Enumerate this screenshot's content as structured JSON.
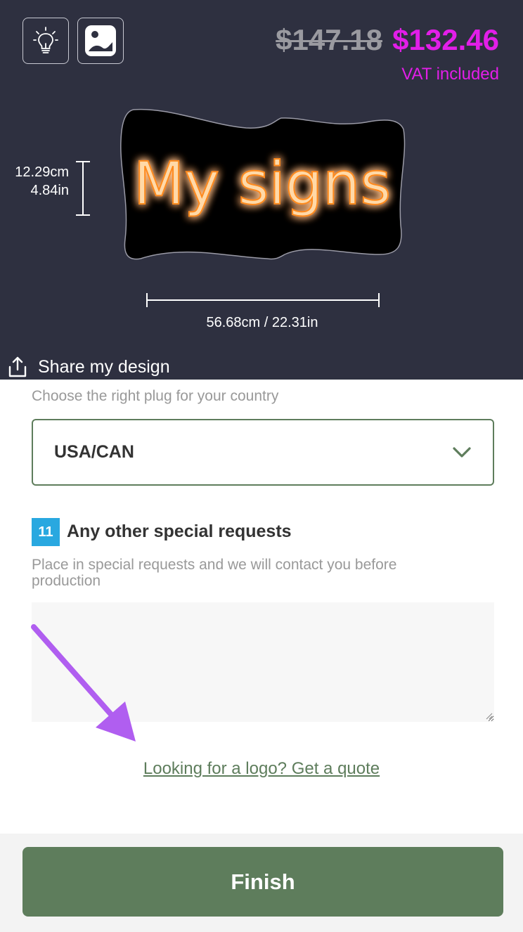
{
  "colors": {
    "accent": "#e21ee8",
    "primary_green": "#5e7d5c",
    "step_blue": "#29a8e0",
    "preview_bg": "#2e3040",
    "neon_orange": "#ff8a1c"
  },
  "toolbar": {
    "icons": [
      "lightbulb-icon",
      "image-icon"
    ]
  },
  "price": {
    "original": "$147.18",
    "current": "$132.46",
    "vat_note": "VAT included"
  },
  "sign": {
    "text": "My signs",
    "height_cm": "12.29cm",
    "height_in": "4.84in",
    "width_label": "56.68cm / 22.31in"
  },
  "share": {
    "label": "Share my design",
    "icon": "share-icon"
  },
  "plug": {
    "label": "Choose the right plug for your country",
    "selected": "USA/CAN"
  },
  "requests": {
    "step_number": "11",
    "title": "Any other special requests",
    "description": "Place in special requests and we will contact you before production",
    "value": ""
  },
  "logo_link": "Looking for a logo? Get a quote",
  "finish_label": "Finish"
}
